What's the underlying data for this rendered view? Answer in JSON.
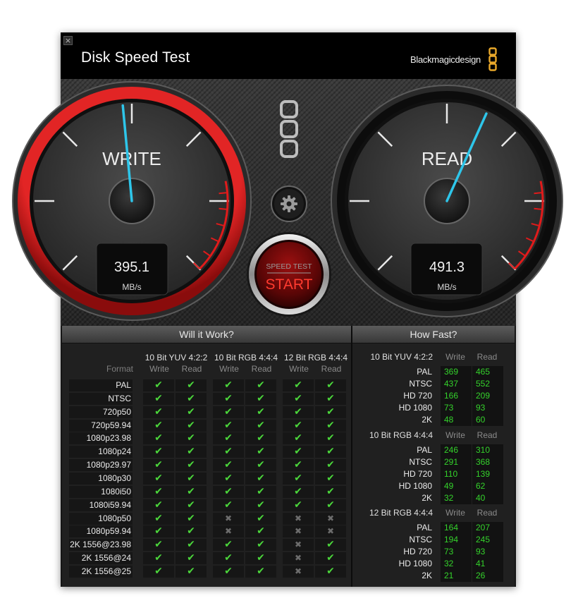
{
  "window": {
    "title": "Disk Speed Test",
    "brand": "Blackmagicdesign",
    "close_glyph": "×"
  },
  "icons": {
    "close": "close-icon",
    "settings": "gear-icon",
    "logo": "blackmagic-logo-icon"
  },
  "colors": {
    "accent_red": "#d81c1c",
    "needle": "#2ec6ea",
    "check": "#4bd63b",
    "speed_value": "#34d22b"
  },
  "write_gauge": {
    "label": "WRITE",
    "value": "395.1",
    "unit": "MB/s",
    "needle_fraction": 0.48
  },
  "read_gauge": {
    "label": "READ",
    "value": "491.3",
    "unit": "MB/s",
    "needle_fraction": 0.59
  },
  "start_button": {
    "top": "SPEED TEST",
    "main": "START"
  },
  "will_it_work": {
    "title": "Will it Work?",
    "format_header": "Format",
    "groups": [
      {
        "name": "10 Bit YUV 4:2:2",
        "cols": [
          "Write",
          "Read"
        ]
      },
      {
        "name": "10 Bit RGB 4:4:4",
        "cols": [
          "Write",
          "Read"
        ]
      },
      {
        "name": "12 Bit RGB 4:4:4",
        "cols": [
          "Write",
          "Read"
        ]
      }
    ],
    "rows": [
      {
        "format": "PAL",
        "results": [
          1,
          1,
          1,
          1,
          1,
          1
        ]
      },
      {
        "format": "NTSC",
        "results": [
          1,
          1,
          1,
          1,
          1,
          1
        ]
      },
      {
        "format": "720p50",
        "results": [
          1,
          1,
          1,
          1,
          1,
          1
        ]
      },
      {
        "format": "720p59.94",
        "results": [
          1,
          1,
          1,
          1,
          1,
          1
        ]
      },
      {
        "format": "1080p23.98",
        "results": [
          1,
          1,
          1,
          1,
          1,
          1
        ]
      },
      {
        "format": "1080p24",
        "results": [
          1,
          1,
          1,
          1,
          1,
          1
        ]
      },
      {
        "format": "1080p29.97",
        "results": [
          1,
          1,
          1,
          1,
          1,
          1
        ]
      },
      {
        "format": "1080p30",
        "results": [
          1,
          1,
          1,
          1,
          1,
          1
        ]
      },
      {
        "format": "1080i50",
        "results": [
          1,
          1,
          1,
          1,
          1,
          1
        ]
      },
      {
        "format": "1080i59.94",
        "results": [
          1,
          1,
          1,
          1,
          1,
          1
        ]
      },
      {
        "format": "1080p50",
        "results": [
          1,
          1,
          0,
          1,
          0,
          0
        ]
      },
      {
        "format": "1080p59.94",
        "results": [
          1,
          1,
          0,
          1,
          0,
          0
        ]
      },
      {
        "format": "2K 1556@23.98",
        "results": [
          1,
          1,
          1,
          1,
          0,
          1
        ]
      },
      {
        "format": "2K 1556@24",
        "results": [
          1,
          1,
          1,
          1,
          0,
          1
        ]
      },
      {
        "format": "2K 1556@25",
        "results": [
          1,
          1,
          1,
          1,
          0,
          1
        ]
      }
    ]
  },
  "how_fast": {
    "title": "How Fast?",
    "sections": [
      {
        "name": "10 Bit YUV 4:2:2",
        "write_label": "Write",
        "read_label": "Read",
        "rows": [
          {
            "label": "PAL",
            "write": "369",
            "read": "465"
          },
          {
            "label": "NTSC",
            "write": "437",
            "read": "552"
          },
          {
            "label": "HD 720",
            "write": "166",
            "read": "209"
          },
          {
            "label": "HD 1080",
            "write": "73",
            "read": "93"
          },
          {
            "label": "2K",
            "write": "48",
            "read": "60"
          }
        ]
      },
      {
        "name": "10 Bit RGB 4:4:4",
        "write_label": "Write",
        "read_label": "Read",
        "rows": [
          {
            "label": "PAL",
            "write": "246",
            "read": "310"
          },
          {
            "label": "NTSC",
            "write": "291",
            "read": "368"
          },
          {
            "label": "HD 720",
            "write": "110",
            "read": "139"
          },
          {
            "label": "HD 1080",
            "write": "49",
            "read": "62"
          },
          {
            "label": "2K",
            "write": "32",
            "read": "40"
          }
        ]
      },
      {
        "name": "12 Bit RGB 4:4:4",
        "write_label": "Write",
        "read_label": "Read",
        "rows": [
          {
            "label": "PAL",
            "write": "164",
            "read": "207"
          },
          {
            "label": "NTSC",
            "write": "194",
            "read": "245"
          },
          {
            "label": "HD 720",
            "write": "73",
            "read": "93"
          },
          {
            "label": "HD 1080",
            "write": "32",
            "read": "41"
          },
          {
            "label": "2K",
            "write": "21",
            "read": "26"
          }
        ]
      }
    ]
  }
}
